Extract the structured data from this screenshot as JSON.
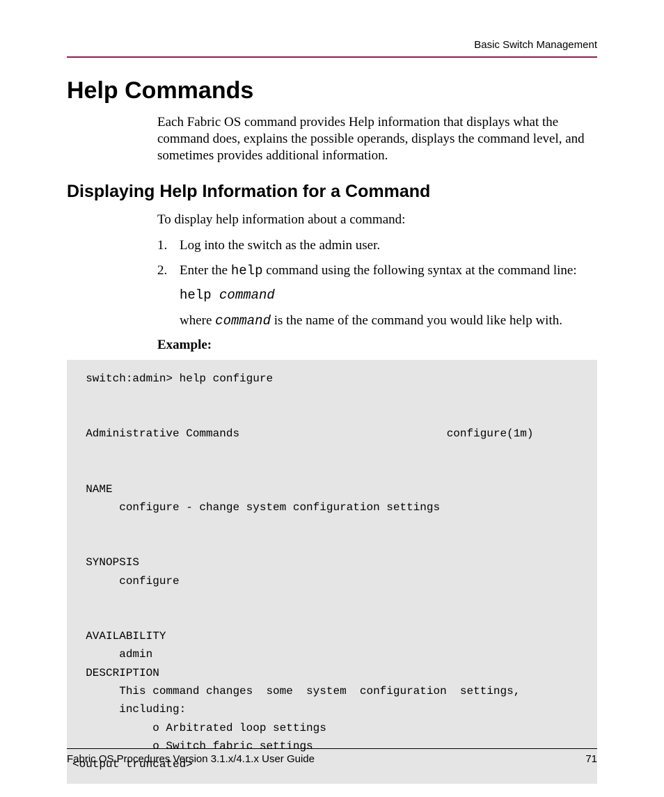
{
  "header": {
    "section": "Basic Switch Management"
  },
  "h1": "Help Commands",
  "intro": "Each Fabric OS command provides Help information that displays what the command does, explains the possible operands, displays the command level, and sometimes provides additional information.",
  "h2": "Displaying Help Information for a Command",
  "lead": "To display help information about a command:",
  "steps": {
    "s1": "Log into the switch as the admin user.",
    "s2_pre": "Enter the ",
    "s2_cmd": "help",
    "s2_post": " command using the following syntax at the command line:",
    "s2_syntax_cmd": "help ",
    "s2_syntax_arg": "command",
    "s2_where_pre": "where ",
    "s2_where_arg": "command",
    "s2_where_post": " is the name of the command you would like help with."
  },
  "example_label": "Example:",
  "code": "  switch:admin> help configure\n\n\n  Administrative Commands                               configure(1m)\n\n\n  NAME\n       configure - change system configuration settings\n\n\n  SYNOPSIS\n       configure\n\n\n  AVAILABILITY\n       admin\n  DESCRIPTION\n       This command changes  some  system  configuration  settings,\n       including:\n            o Arbitrated loop settings\n            o Switch fabric settings\n<output truncated>",
  "footer": {
    "title": "Fabric OS Procedures Version 3.1.x/4.1.x User Guide",
    "page": "71"
  }
}
